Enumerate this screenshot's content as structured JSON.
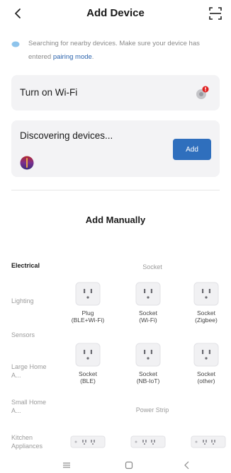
{
  "header": {
    "title": "Add Device"
  },
  "status": {
    "text": "Searching for nearby devices. Make sure your device has entered ",
    "link": "pairing mode",
    "tail": "."
  },
  "wifi_card": {
    "label": "Turn on Wi-Fi"
  },
  "discover_card": {
    "label": "Discovering devices...",
    "add_label": "Add"
  },
  "manual": {
    "title": "Add Manually"
  },
  "categories": [
    {
      "label": "Electrical"
    },
    {
      "label": "Lighting"
    },
    {
      "label": "Sensors"
    },
    {
      "label": "Large Home A..."
    },
    {
      "label": "Small Home A..."
    },
    {
      "label": "Kitchen Appliances"
    }
  ],
  "sections": [
    {
      "title": "Socket"
    },
    {
      "title": "Power Strip"
    }
  ],
  "devices": [
    {
      "line1": "Plug",
      "line2": "(BLE+Wi-Fi)"
    },
    {
      "line1": "Socket",
      "line2": "(Wi-Fi)"
    },
    {
      "line1": "Socket",
      "line2": "(Zigbee)"
    },
    {
      "line1": "Socket",
      "line2": "(BLE)"
    },
    {
      "line1": "Socket",
      "line2": "(NB-IoT)"
    },
    {
      "line1": "Socket",
      "line2": "(other)"
    }
  ],
  "colors": {
    "accent": "#2f6fbd",
    "card_bg": "#f3f3f5",
    "badge": "#e02020"
  }
}
